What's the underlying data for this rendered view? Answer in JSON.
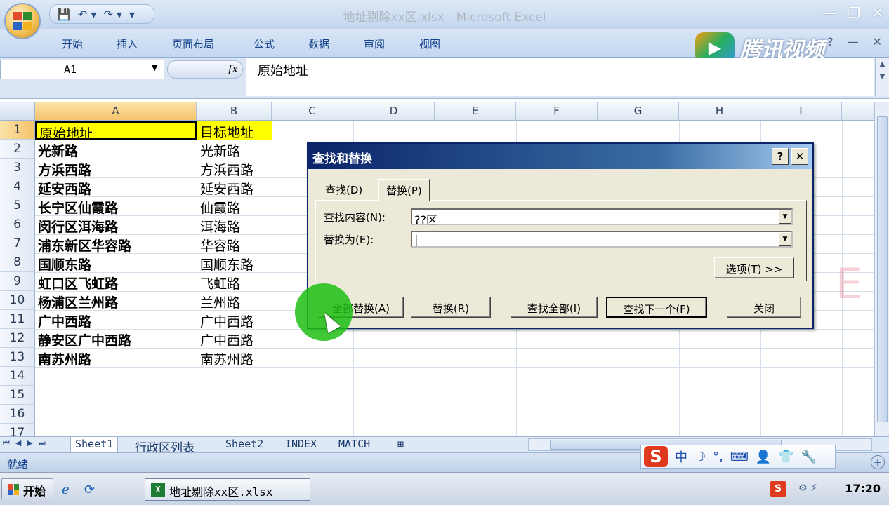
{
  "window": {
    "title": "地址剔除xx区.xlsx - Microsoft Excel",
    "minimize": "—",
    "restore": "❐",
    "close": "✕"
  },
  "qat": {
    "save": "💾",
    "undo": "↶ ▾",
    "redo": "↷ ▾",
    "more": "▾"
  },
  "ribbon": {
    "tabs": [
      "开始",
      "插入",
      "页面布局",
      "公式",
      "数据",
      "审阅",
      "视图"
    ],
    "help": "?",
    "inner_min": "—",
    "inner_close": "✕"
  },
  "watermark": {
    "brand": "腾讯视频"
  },
  "formula_bar": {
    "namebox": "A1",
    "fx": "fx",
    "value": "原始地址"
  },
  "grid": {
    "columns": [
      "A",
      "B",
      "C",
      "D",
      "E",
      "F",
      "G",
      "H",
      "I"
    ],
    "rows": [
      "1",
      "2",
      "3",
      "4",
      "5",
      "6",
      "7",
      "8",
      "9",
      "10",
      "11",
      "12",
      "13",
      "14",
      "15",
      "16",
      "17"
    ],
    "col_a": [
      "原始地址",
      "光新路",
      "方浜西路",
      "延安西路",
      "长宁区仙霞路",
      "闵行区洱海路",
      "浦东新区华容路",
      "国顺东路",
      "虹口区飞虹路",
      "杨浦区兰州路",
      "广中西路",
      "静安区广中西路",
      "南苏州路"
    ],
    "col_b": [
      "目标地址",
      "光新路",
      "方浜西路",
      "延安西路",
      "仙霞路",
      "洱海路",
      "华容路",
      "国顺东路",
      "飞虹路",
      "兰州路",
      "广中西路",
      "广中西路",
      "南苏州路"
    ]
  },
  "sheets": {
    "nav": [
      "⏮",
      "◀",
      "▶",
      "⏭"
    ],
    "tabs": [
      "Sheet1",
      "行政区列表",
      "Sheet2",
      "INDEX",
      "MATCH"
    ]
  },
  "status": {
    "text": "就绪",
    "zoom_plus": "+"
  },
  "ime": {
    "logo": "S",
    "items": [
      "中",
      "☽",
      "°,",
      "⌨",
      "👤",
      "👕",
      "🔧"
    ]
  },
  "taskbar": {
    "start": "开始",
    "task": "地址剔除xx区.xlsx",
    "clock": "17:20",
    "sogou": "S"
  },
  "dialog": {
    "title": "查找和替换",
    "help": "?",
    "close": "✕",
    "tabs": [
      "查找(D)",
      "替换(P)"
    ],
    "find_label": "查找内容(N):",
    "find_value": "??区",
    "replace_label": "替换为(E):",
    "replace_value": "|",
    "options_button": "选项(T) >>",
    "buttons": [
      "全部替换(A)",
      "替换(R)",
      "查找全部(I)",
      "查找下一个(F)",
      "关闭"
    ]
  }
}
